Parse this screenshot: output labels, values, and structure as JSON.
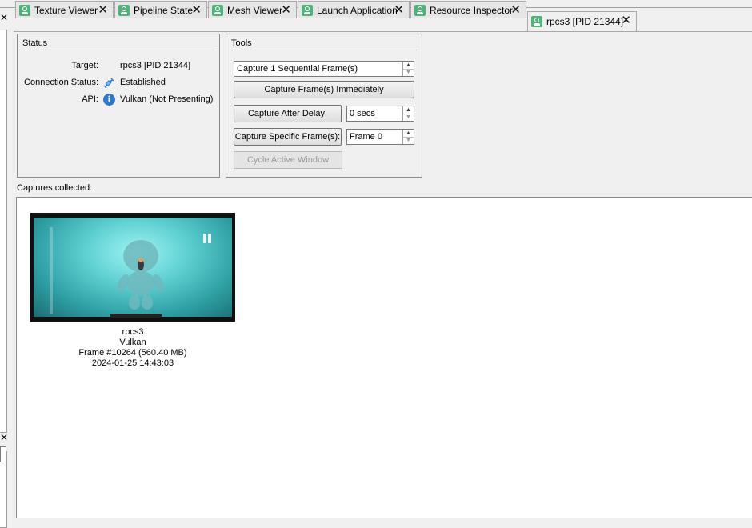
{
  "tabs": [
    {
      "label": "Texture Viewer"
    },
    {
      "label": "Pipeline State"
    },
    {
      "label": "Mesh Viewer"
    },
    {
      "label": "Launch Application"
    },
    {
      "label": "Resource Inspector"
    },
    {
      "label": "rpcs3 [PID 21344]"
    }
  ],
  "status": {
    "title": "Status",
    "target_label": "Target:",
    "target_value": "rpcs3 [PID 21344]",
    "connection_label": "Connection Status:",
    "connection_value": "Established",
    "api_label": "API:",
    "api_value": "Vulkan (Not Presenting)"
  },
  "tools": {
    "title": "Tools",
    "sequential_value": "Capture 1 Sequential Frame(s)",
    "capture_now_label": "Capture Frame(s) Immediately",
    "capture_delay_label": "Capture After Delay:",
    "delay_value": "0 secs",
    "capture_specific_label": "Capture Specific Frame(s):",
    "frame_value": "Frame 0",
    "cycle_window_label": "Cycle Active Window"
  },
  "captures": {
    "label": "Captures collected:",
    "items": [
      {
        "name": "rpcs3",
        "api": "Vulkan",
        "frame": "Frame #10264 (560.40 MB)",
        "timestamp": "2024-01-25 14:43:03"
      }
    ]
  },
  "icons": {
    "tab": "viewer-icon",
    "connection": "connection-plug-icon",
    "api": "info-icon"
  },
  "colors": {
    "tab_icon": "#4fb37a",
    "info_icon": "#2a78d6"
  }
}
